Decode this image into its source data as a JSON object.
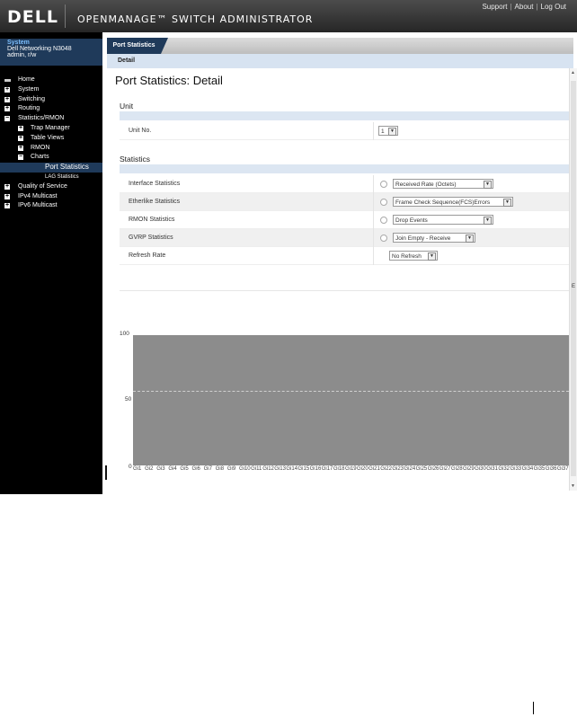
{
  "header": {
    "logo": "DELL",
    "title": "OPENMANAGE™ SWITCH ADMINISTRATOR",
    "links": [
      "Support",
      "About",
      "Log Out"
    ]
  },
  "system": {
    "title": "System",
    "model": "Dell Networking N3048",
    "user": "admin, r/w"
  },
  "nav": {
    "home": "Home",
    "system": "System",
    "switching": "Switching",
    "routing": "Routing",
    "stats": "Statistics/RMON",
    "trap": "Trap Manager",
    "tables": "Table Views",
    "rmon": "RMON",
    "charts": "Charts",
    "port_stats": "Port Statistics",
    "lag_stats": "LAG Statistics",
    "qos": "Quality of Service",
    "ipv4": "IPv4 Multicast",
    "ipv6": "IPv6 Multicast"
  },
  "tabs": {
    "active": "Port Statistics",
    "sub": "Detail"
  },
  "page": {
    "title": "Port Statistics: Detail",
    "unit_section": "Unit",
    "unit_label": "Unit No.",
    "unit_value": "1",
    "stats_section": "Statistics",
    "rows": [
      {
        "label": "Interface Statistics",
        "value": "Received Rate (Octets)"
      },
      {
        "label": "Etherlike Statistics",
        "value": "Frame Check Sequence(FCS)Errors"
      },
      {
        "label": "RMON Statistics",
        "value": "Drop Events"
      },
      {
        "label": "GVRP Statistics",
        "value": "Join Empty - Receive"
      }
    ],
    "refresh_label": "Refresh Rate",
    "refresh_value": "No Refresh",
    "scroll_marker": "E"
  },
  "chart_data": {
    "type": "bar",
    "categories": [
      "Gi1",
      "Gi2",
      "Gi3",
      "Gi4",
      "Gi5",
      "Gi6",
      "Gi7",
      "Gi8",
      "Gi9",
      "Gi10",
      "Gi11",
      "Gi12",
      "Gi13",
      "Gi14",
      "Gi15",
      "Gi16",
      "Gi17",
      "Gi18",
      "Gi19",
      "Gi20",
      "Gi21",
      "Gi22",
      "Gi23",
      "Gi24",
      "Gi25",
      "Gi26",
      "Gi27",
      "Gi28",
      "Gi29",
      "Gi30",
      "Gi31",
      "Gi32",
      "Gi33",
      "Gi34",
      "Gi35",
      "Gi36",
      "Gi37"
    ],
    "yticks": [
      "100",
      "50",
      "0"
    ],
    "ylim": [
      0,
      100
    ]
  }
}
